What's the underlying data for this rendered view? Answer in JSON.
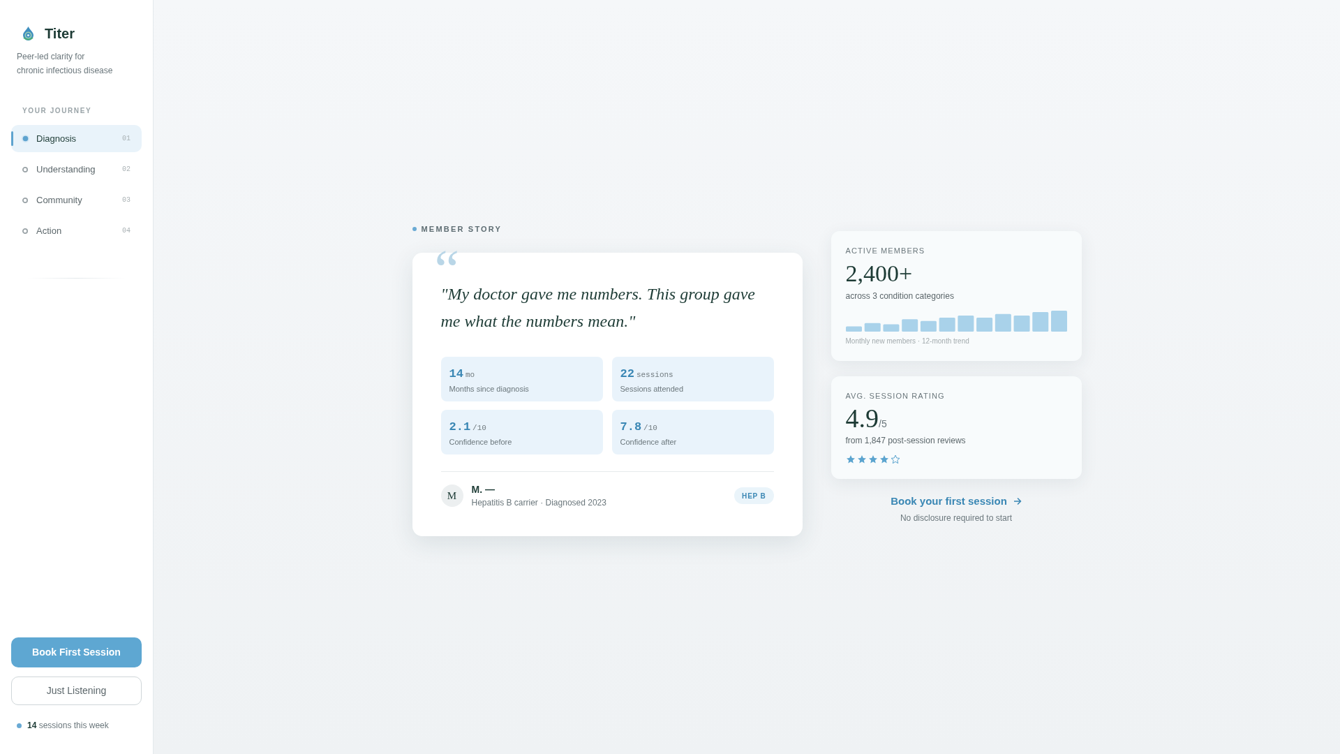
{
  "sidebar": {
    "brand": {
      "name": "Titer",
      "tagline_lines": [
        "Peer-led clarity for",
        "chronic infectious disease"
      ]
    },
    "journey": {
      "heading": "YOUR JOURNEY",
      "items": [
        {
          "label": "Diagnosis",
          "number": "01",
          "selected": true
        },
        {
          "label": "Understanding",
          "number": "02",
          "selected": false
        },
        {
          "label": "Community",
          "number": "03",
          "selected": false
        },
        {
          "label": "Action",
          "number": "04",
          "selected": false
        }
      ]
    },
    "actions": [
      {
        "label": "Book First Session",
        "kind": "primary"
      },
      {
        "label": "Just Listening",
        "kind": "secondary"
      }
    ],
    "activity": "**14** sessions this week"
  },
  "member_story": {
    "label": "MEMBER STORY",
    "quote_mark": "“",
    "quote": "\"My doctor gave me numbers. This group gave me what the numbers mean.\"",
    "stats": [
      {
        "value": "14",
        "unit": "mo",
        "caption": "Months since diagnosis"
      },
      {
        "value": "22",
        "unit": "sessions",
        "caption": "Sessions attended"
      },
      {
        "value": "2.1",
        "unit": "/10",
        "caption": "Confidence before"
      },
      {
        "value": "7.8",
        "unit": "/10",
        "caption": "Confidence after"
      }
    ],
    "author": {
      "initial": "M",
      "name": "M. —",
      "detail": "Hepatitis B carrier · Diagnosed 2023",
      "tag": "HEP B"
    }
  },
  "metrics": [
    {
      "kind": "trend",
      "label": "ACTIVE MEMBERS",
      "value": "2,400+",
      "caption": "across 3 condition categories",
      "footnote": "Monthly new members · 12-month trend"
    },
    {
      "kind": "rating",
      "label": "AVG. SESSION RATING",
      "value": "4.9",
      "unit": "/5",
      "caption": "from 1,847 post-session reviews",
      "stars": 4
    }
  ],
  "cta": {
    "label": "Book your first session",
    "note": "No disclosure required to start"
  }
}
